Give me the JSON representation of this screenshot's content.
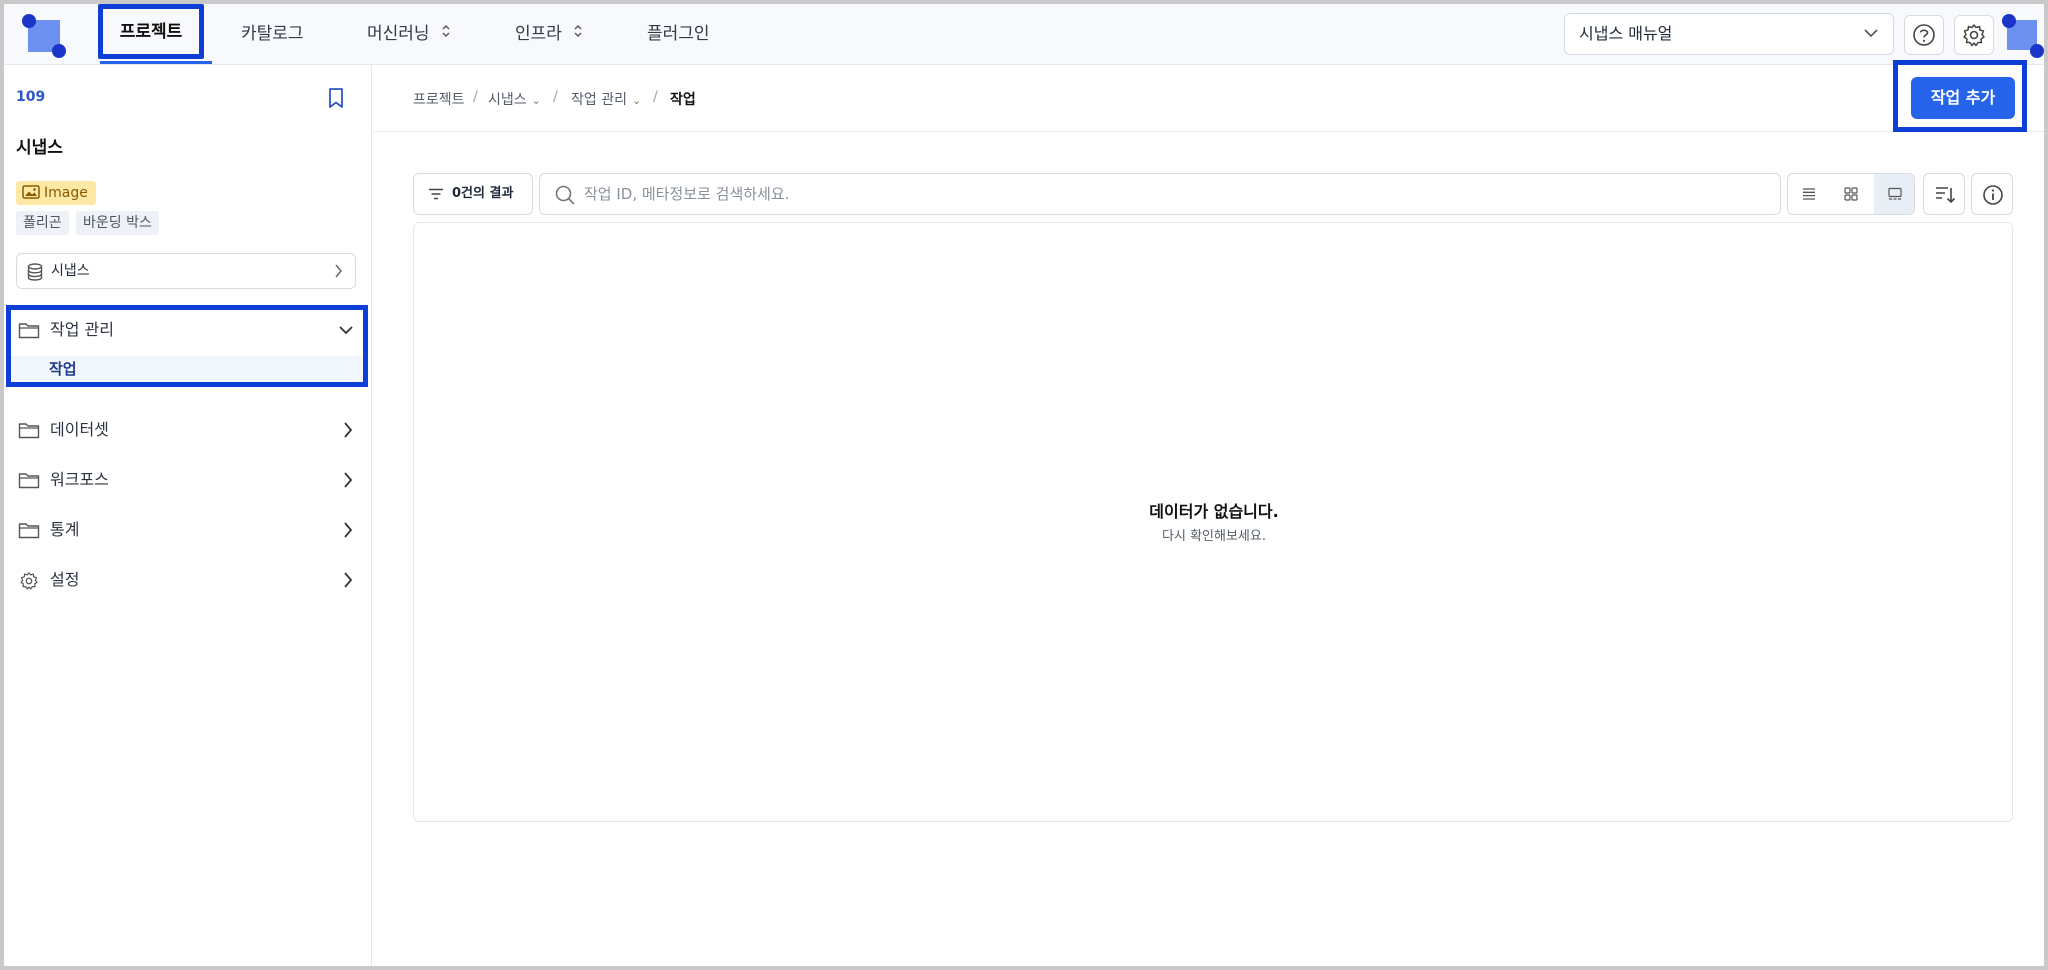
{
  "topbar": {
    "nav": [
      {
        "label": "프로젝트",
        "active": true
      },
      {
        "label": "카탈로그"
      },
      {
        "label": "머신러닝",
        "chevron": "⌃⌄"
      },
      {
        "label": "인프라",
        "chevron": "⌃⌄"
      },
      {
        "label": "플러그인"
      }
    ],
    "manual_select": {
      "value": "시냅스 매뉴얼"
    },
    "icons": [
      "help-icon",
      "gear-icon",
      "avatar"
    ]
  },
  "sidebar": {
    "project_id": "109",
    "project_name": "시냅스",
    "data_type_tag": "Image",
    "annotation_tags": [
      "폴리곤",
      "바운딩 박스"
    ],
    "dataset_button": "시냅스",
    "menu": [
      {
        "label": "작업 관리",
        "icon": "folder-icon",
        "expanded": true,
        "children": [
          {
            "label": "작업",
            "active": true
          }
        ]
      },
      {
        "label": "데이터셋",
        "icon": "folder-icon"
      },
      {
        "label": "워크포스",
        "icon": "folder-icon"
      },
      {
        "label": "통계",
        "icon": "folder-icon"
      },
      {
        "label": "설정",
        "icon": "gear-icon"
      }
    ]
  },
  "main": {
    "breadcrumb": [
      {
        "label": "프로젝트"
      },
      {
        "label": "시냅스",
        "dropdown": true
      },
      {
        "label": "작업 관리",
        "dropdown": true
      },
      {
        "label": "작업",
        "current": true
      }
    ],
    "add_button": "작업 추가",
    "filter_button": "0건의 결과",
    "search": {
      "placeholder": "작업 ID, 메타정보로 검색하세요.",
      "value": ""
    },
    "view_modes": [
      "list-view-icon",
      "grid-view-icon",
      "gallery-view-icon"
    ],
    "active_view": "gallery-view-icon",
    "empty_state": {
      "title": "데이터가 없습니다.",
      "subtitle": "다시 확인해보세요."
    }
  },
  "colors": {
    "accent": "#2563eb",
    "highlight": "#0d3fd6",
    "tag_image_bg": "#fde9a6"
  }
}
